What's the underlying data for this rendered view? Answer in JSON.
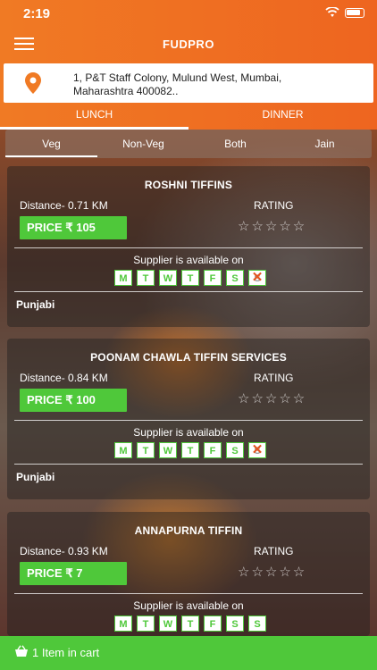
{
  "status": {
    "time": "2:19"
  },
  "header": {
    "title": "FUDPRO"
  },
  "address": {
    "text": "1, P&T Staff Colony, Mulund West, Mumbai, Maharashtra 400082.."
  },
  "meal_tabs": [
    {
      "label": "LUNCH",
      "active": true
    },
    {
      "label": "DINNER",
      "active": false
    }
  ],
  "filter_tabs": [
    {
      "label": "Veg",
      "active": true
    },
    {
      "label": "Non-Veg",
      "active": false
    },
    {
      "label": "Both",
      "active": false
    },
    {
      "label": "Jain",
      "active": false
    }
  ],
  "cards": [
    {
      "name": "ROSHNI TIFFINS",
      "distance": "Distance- 0.71 KM",
      "rating_label": "RATING",
      "rating": 0,
      "price": "PRICE ₹ 105",
      "supplier_text": "Supplier is available on",
      "days": [
        {
          "label": "M",
          "available": true
        },
        {
          "label": "T",
          "available": true
        },
        {
          "label": "W",
          "available": true
        },
        {
          "label": "T",
          "available": true
        },
        {
          "label": "F",
          "available": true
        },
        {
          "label": "S",
          "available": true
        },
        {
          "label": "S",
          "available": false
        }
      ],
      "cuisine": "Punjabi"
    },
    {
      "name": "POONAM CHAWLA TIFFIN SERVICES",
      "distance": "Distance- 0.84 KM",
      "rating_label": "RATING",
      "rating": 0,
      "price": "PRICE ₹ 100",
      "supplier_text": "Supplier is available on",
      "days": [
        {
          "label": "M",
          "available": true
        },
        {
          "label": "T",
          "available": true
        },
        {
          "label": "W",
          "available": true
        },
        {
          "label": "T",
          "available": true
        },
        {
          "label": "F",
          "available": true
        },
        {
          "label": "S",
          "available": true
        },
        {
          "label": "S",
          "available": false
        }
      ],
      "cuisine": "Punjabi"
    },
    {
      "name": "ANNAPURNA TIFFIN",
      "distance": "Distance- 0.93 KM",
      "rating_label": "RATING",
      "rating": 0,
      "price": "PRICE ₹ 7",
      "supplier_text": "Supplier is available on",
      "days": [
        {
          "label": "M",
          "available": true
        },
        {
          "label": "T",
          "available": true
        },
        {
          "label": "W",
          "available": true
        },
        {
          "label": "T",
          "available": true
        },
        {
          "label": "F",
          "available": true
        },
        {
          "label": "S",
          "available": true
        },
        {
          "label": "S",
          "available": true
        }
      ],
      "cuisine": ""
    }
  ],
  "cart": {
    "text": "1 Item in cart"
  },
  "colors": {
    "brand_orange": "#ee6520",
    "accent_green": "#4fc83a",
    "unavailable_red": "#e5541e"
  }
}
